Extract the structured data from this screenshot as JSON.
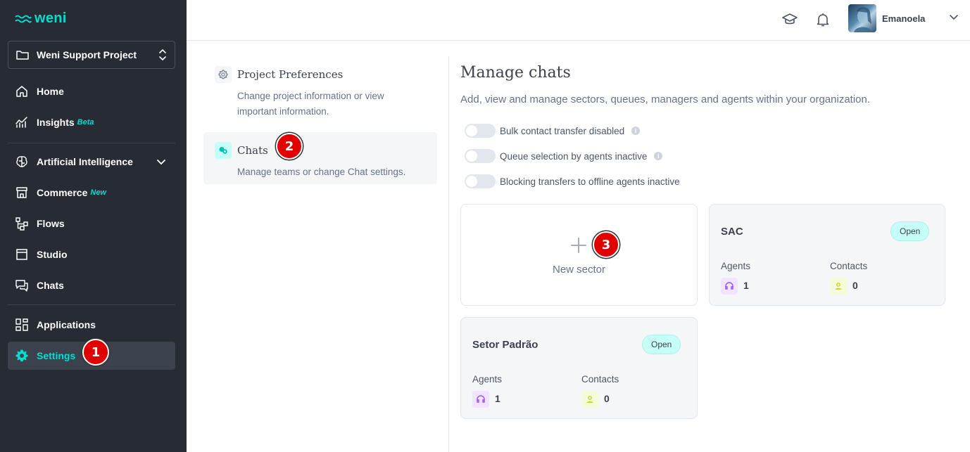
{
  "brand": {
    "logo_text": "weni",
    "accent": "#00ded2"
  },
  "sidebar": {
    "project": "Weni Support Project",
    "items": [
      {
        "label": "Home",
        "icon": "home-icon"
      },
      {
        "label": "Insights",
        "tag": "Beta",
        "icon": "chart-icon"
      },
      {
        "label": "Artificial Intelligence",
        "icon": "brain-icon"
      },
      {
        "label": "Commerce",
        "tag": "New",
        "icon": "store-icon"
      },
      {
        "label": "Flows",
        "icon": "flows-icon"
      },
      {
        "label": "Studio",
        "icon": "window-icon"
      },
      {
        "label": "Chats",
        "icon": "chat-icon"
      },
      {
        "label": "Applications",
        "icon": "apps-icon"
      },
      {
        "label": "Settings",
        "icon": "gear-icon",
        "active": true
      }
    ]
  },
  "header": {
    "user_name": "Emanoela"
  },
  "settings_menu": [
    {
      "title": "Project Preferences",
      "description": "Change project information or view important information."
    },
    {
      "title": "Chats",
      "description": "Manage teams or change Chat settings.",
      "active": true
    }
  ],
  "main": {
    "title": "Manage chats",
    "description": "Add, view and manage sectors, queues, managers and agents within your organization.",
    "toggles": [
      {
        "label": "Bulk contact transfer disabled",
        "info": true,
        "on": false
      },
      {
        "label": "Queue selection by agents inactive",
        "info": true,
        "on": false
      },
      {
        "label": "Blocking transfers to offline agents inactive",
        "info": false,
        "on": false
      }
    ],
    "new_sector_label": "New sector",
    "sectors": [
      {
        "name": "SAC",
        "status": "Open",
        "agents_label": "Agents",
        "agents": "1",
        "contacts_label": "Contacts",
        "contacts": "0"
      },
      {
        "name": "Setor Padrão",
        "status": "Open",
        "agents_label": "Agents",
        "agents": "1",
        "contacts_label": "Contacts",
        "contacts": "0"
      }
    ]
  },
  "markers": [
    "1",
    "2",
    "3"
  ]
}
